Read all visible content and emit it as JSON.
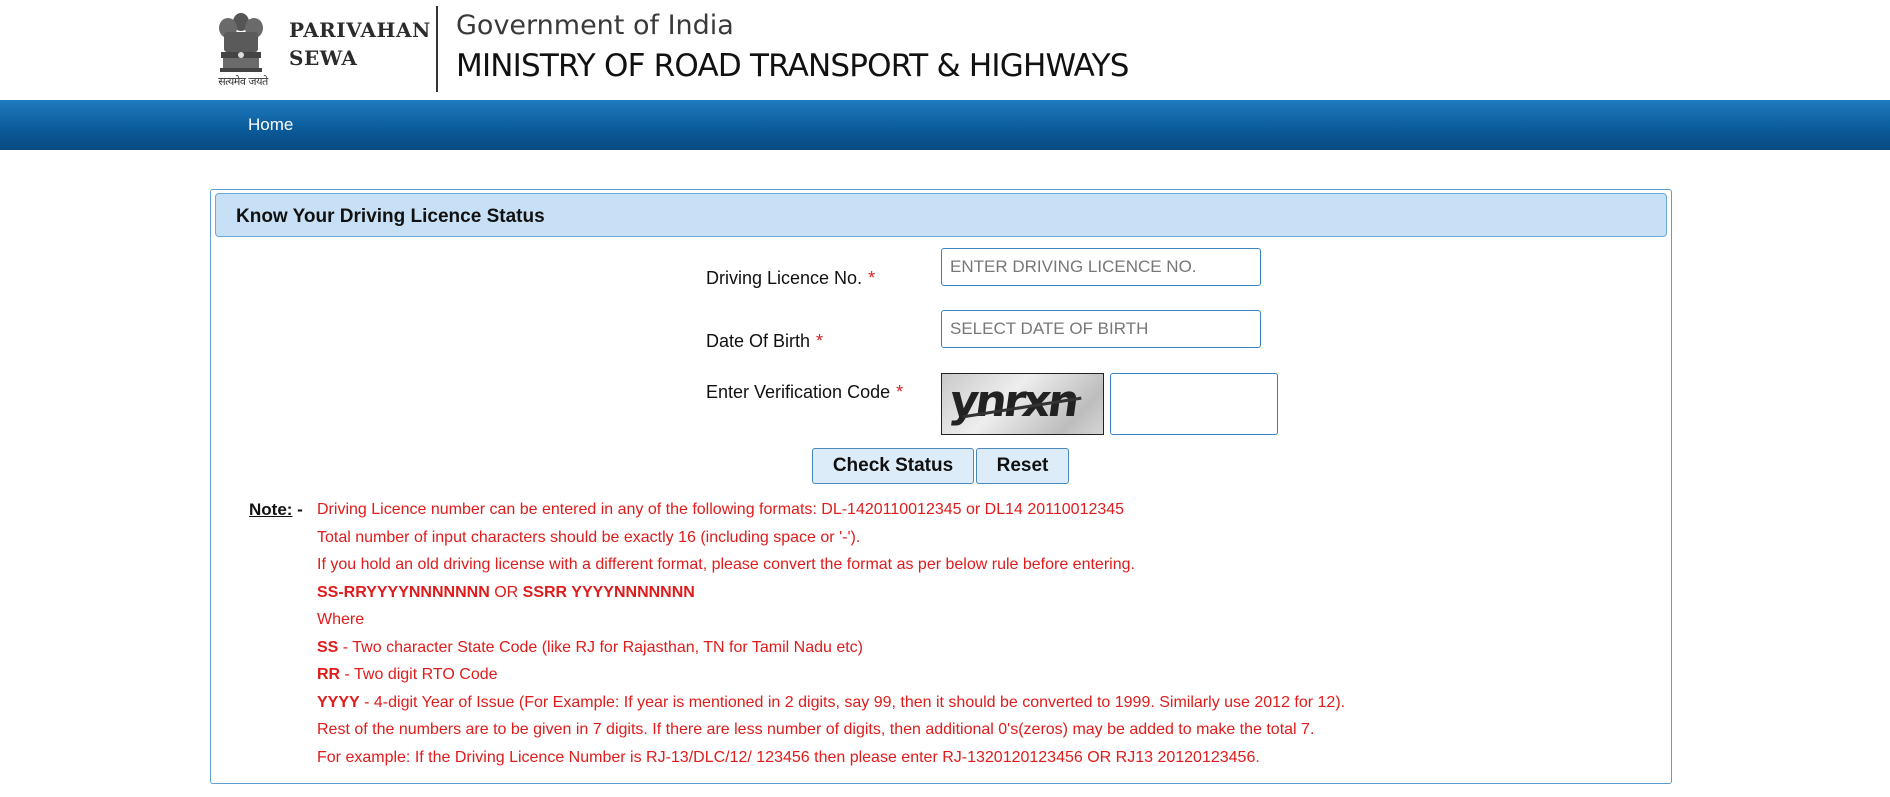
{
  "header": {
    "emblem_motto": "सत्यमेव जयते",
    "brand_line1": "PARIVAHAN",
    "brand_line2": "SEWA",
    "government": "Government of India",
    "ministry": "MINISTRY OF ROAD TRANSPORT & HIGHWAYS"
  },
  "nav": {
    "home": "Home"
  },
  "form": {
    "title": "Know Your Driving Licence Status",
    "required_mark": "*",
    "dl_label": "Driving Licence No.",
    "dl_placeholder": "ENTER DRIVING LICENCE NO.",
    "dl_value": "",
    "dob_label": "Date Of Birth",
    "dob_placeholder": "SELECT DATE OF BIRTH",
    "dob_value": "",
    "captcha_label": "Enter Verification Code",
    "captcha_text": "ynrxn",
    "captcha_value": "",
    "check_button": "Check Status",
    "reset_button": "Reset"
  },
  "note": {
    "label": "Note:",
    "dash": " -",
    "line1": "Driving Licence number can be entered in any of the following formats: DL-1420110012345 or DL14 20110012345",
    "line2": "Total number of input characters should be exactly 16 (including space or '-').",
    "line3": "If you hold an old driving license with a different format, please convert the format as per below rule before entering.",
    "format_a": "SS-RRYYYYNNNNNNN",
    "format_or": " OR ",
    "format_b": "SSRR YYYYNNNNNNN",
    "where": "Where",
    "ss_key": "SS",
    "ss_text": " - Two character State Code (like RJ for Rajasthan, TN for Tamil Nadu etc)",
    "rr_key": "RR",
    "rr_text": " - Two digit RTO Code",
    "yyyy_key": "YYYY",
    "yyyy_text": " - 4-digit Year of Issue (For Example: If year is mentioned in 2 digits, say 99, then it should be converted to 1999. Similarly use 2012 for 12).",
    "line_rest": "Rest of the numbers are to be given in 7 digits. If there are less number of digits, then additional 0's(zeros) may be added to make the total 7.",
    "line_example": "For example: If the Driving Licence Number is RJ-13/DLC/12/ 123456 then please enter RJ-1320120123456 OR RJ13 20120123456."
  }
}
